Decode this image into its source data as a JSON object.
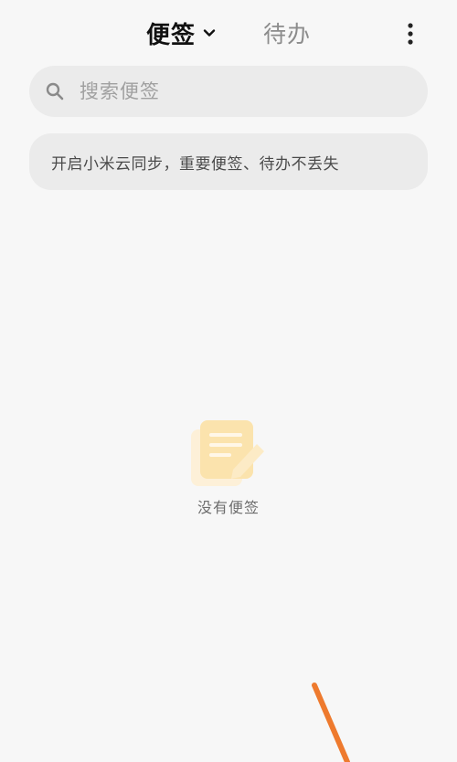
{
  "header": {
    "tabs": [
      {
        "label": "便签",
        "active": true
      },
      {
        "label": "待办",
        "active": false
      }
    ],
    "more_icon": "more-vertical-icon"
  },
  "search": {
    "placeholder": "搜索便签",
    "value": "",
    "icon": "search-icon"
  },
  "sync_banner": {
    "text": "开启小米云同步，重要便签、待办不丢失"
  },
  "empty_state": {
    "icon": "note-edit-icon",
    "text": "没有便签"
  },
  "colors": {
    "background": "#f7f7f7",
    "card": "#ebebeb",
    "accent": "#f5a623",
    "stroke": "#ee7a2e"
  }
}
